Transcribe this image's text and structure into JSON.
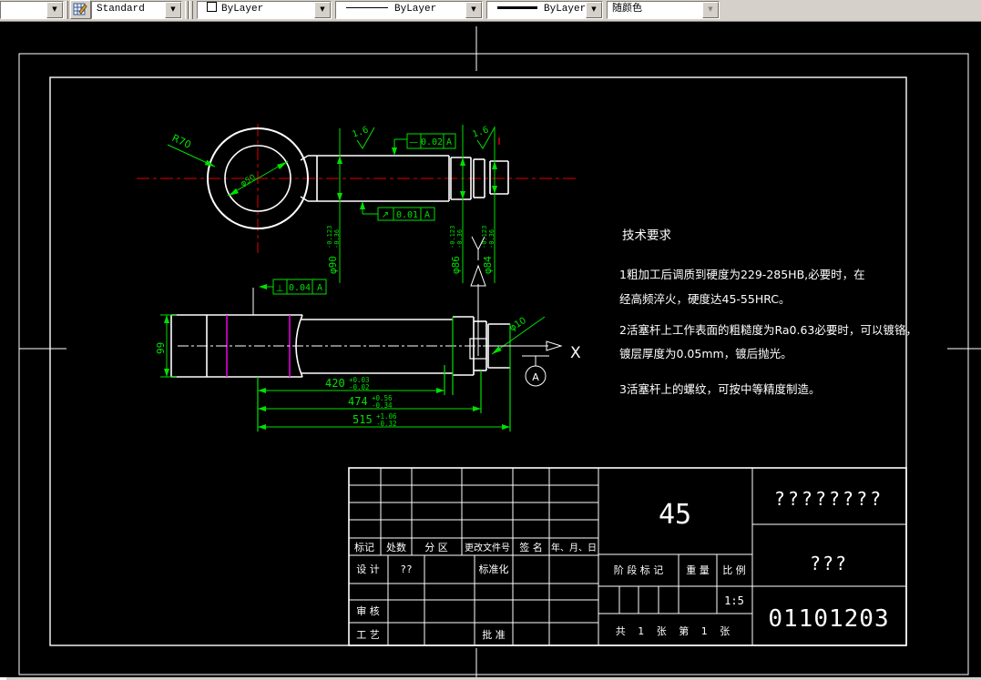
{
  "toolbar": {
    "style": "Standard",
    "color": "ByLayer",
    "linetype": "ByLayer",
    "lineweight": "ByLayer",
    "plotstyle": "随颜色"
  },
  "tech": {
    "title": "技术要求",
    "p1l1": "1粗加工后调质到硬度为229-285HB,必要时，在",
    "p1l2": "经高频淬火，硬度达45-55HRC。",
    "p2l1": "2活塞杆上工作表面的粗糙度为Ra0.63必要时，可以镀铬，",
    "p2l2": "镀层厚度为0.05mm，镀后抛光。",
    "p3l1": "3活塞杆上的螺纹，可按中等精度制造。"
  },
  "dims": {
    "r70": "R70",
    "d50": "φ50",
    "d90": {
      "main": "φ90",
      "up": "-0.123",
      "low": "-0.36"
    },
    "d86": {
      "main": "φ86",
      "up": "-0.123",
      "low": "-0.36"
    },
    "d84": {
      "main": "φ84",
      "up": "-0.123",
      "low": "-0.36"
    },
    "d10": "φ10",
    "len99": "99",
    "d420": {
      "main": "420",
      "up": "+0.03",
      "low": "-0.02"
    },
    "d474": {
      "main": "474",
      "up": "+0.56",
      "low": "-0.34"
    },
    "d515": {
      "main": "515",
      "up": "+1.06",
      "low": "-0.32"
    },
    "rough1": "1.6",
    "rough2": "1.6"
  },
  "fcf": {
    "f1": {
      "sym": "—",
      "val": "0.02",
      "datum": "A"
    },
    "f2": {
      "sym": "↗",
      "val": "0.01",
      "datum": "A"
    },
    "f3": {
      "sym": "⊥",
      "val": "0.04",
      "datum": "A"
    }
  },
  "view": {
    "x_label": "X",
    "datum_a": "A"
  },
  "title_block": {
    "h_biaoji": "标记",
    "h_chushu": "处数",
    "h_fenqu": "分 区",
    "h_wenjianhao": "更改文件号",
    "h_qianming": "签 名",
    "h_riqi": "年、月、日",
    "sheji": "设 计",
    "sheji_val": "??",
    "biaozhunhua": "标准化",
    "shenhe": "审 核",
    "gongyi": "工 艺",
    "pizhun": "批 准",
    "material": "45",
    "jieduan": "阶 段 标 记",
    "zhongliang": "重 量",
    "bili": "比 例",
    "scale": "1:5",
    "sheets": "共 1 张 第 1 张",
    "q8": "????????",
    "q3": "???",
    "number": "01101203"
  }
}
